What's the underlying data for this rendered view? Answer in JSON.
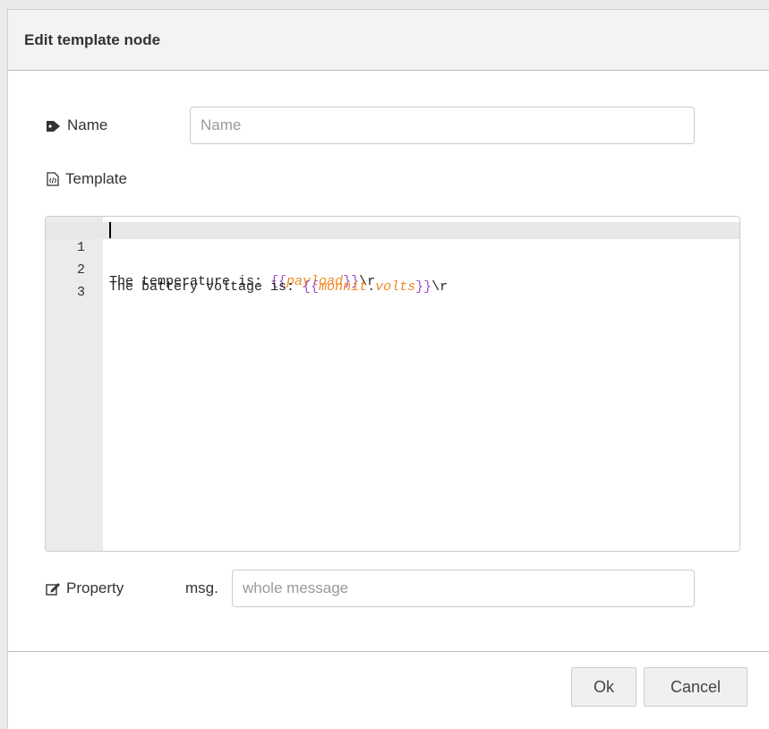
{
  "dialog": {
    "title": "Edit template node"
  },
  "fields": {
    "name": {
      "label": "Name",
      "icon": "tag-icon",
      "placeholder": "Name",
      "value": ""
    },
    "template": {
      "label": "Template",
      "icon": "template-file-icon",
      "lines": [
        {
          "num": "1"
        },
        {
          "num": "2"
        },
        {
          "num": "3"
        }
      ],
      "code": {
        "line1_prefix": "The temperature is: ",
        "line1_open": "{{",
        "line1_var": "payload",
        "line1_close": "}}",
        "line1_suffix": "\\r",
        "line2_prefix": "The battery voltage is: ",
        "line2_open": "{{",
        "line2_var1": "monnit",
        "line2_dot": ".",
        "line2_var2": "volts",
        "line2_close": "}}",
        "line2_suffix": "\\r"
      }
    },
    "property": {
      "label": "Property",
      "icon": "edit-icon",
      "prefix": "msg.",
      "placeholder": "whole message",
      "value": ""
    }
  },
  "buttons": {
    "ok": "Ok",
    "cancel": "Cancel"
  },
  "colors": {
    "brace": "#a14fc9",
    "variable": "#f08a24"
  }
}
